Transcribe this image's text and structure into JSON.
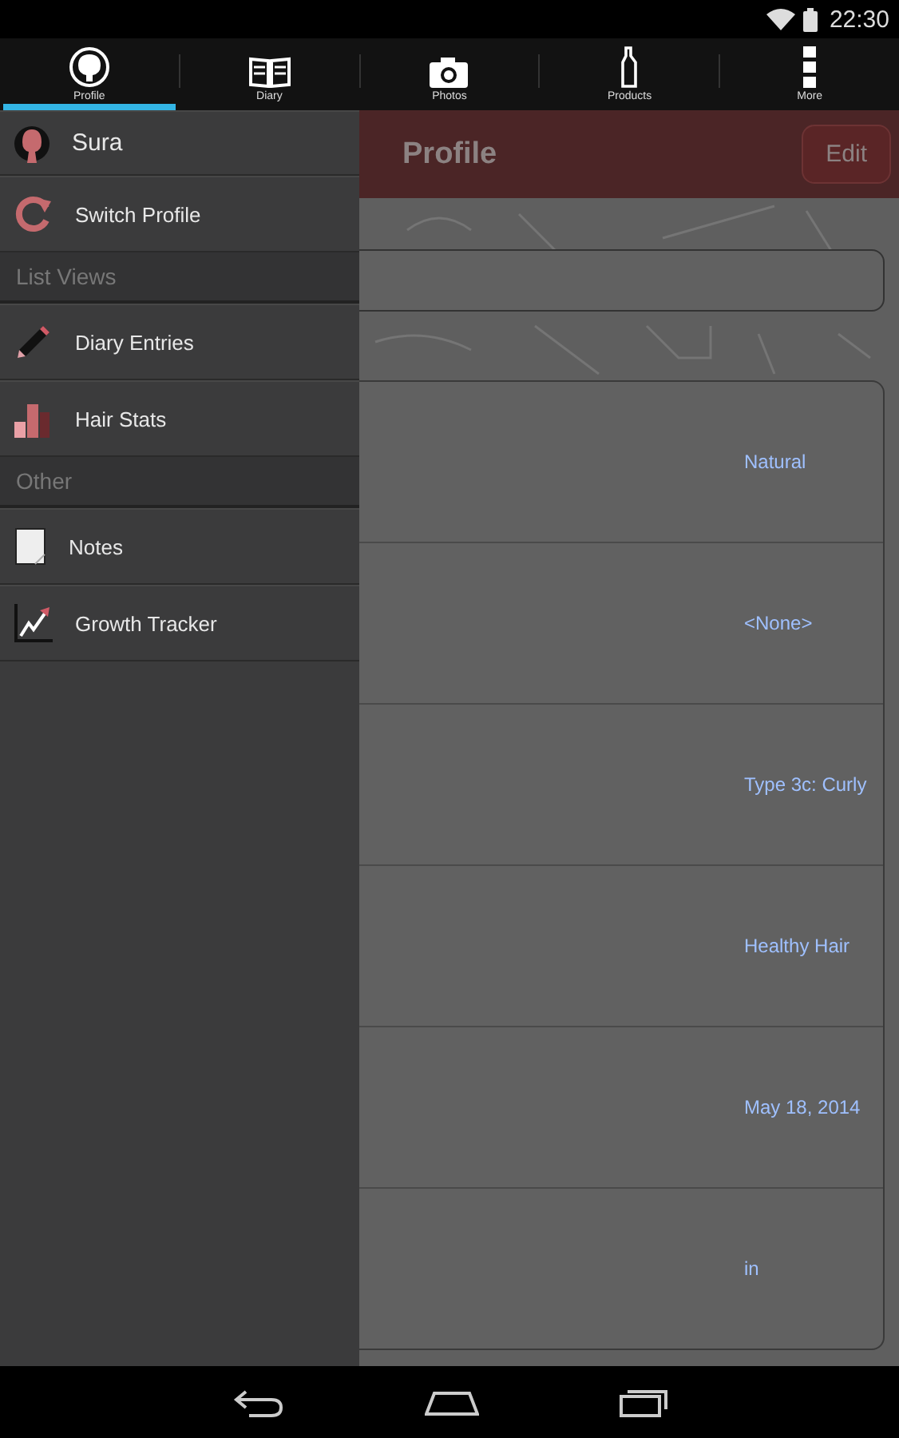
{
  "status_bar": {
    "time": "22:30"
  },
  "tabs": [
    {
      "label": "Profile",
      "selected": true
    },
    {
      "label": "Diary",
      "selected": false
    },
    {
      "label": "Photos",
      "selected": false
    },
    {
      "label": "Products",
      "selected": false
    },
    {
      "label": "More",
      "selected": false
    }
  ],
  "header": {
    "title": "Profile",
    "edit_button": "Edit"
  },
  "profile_rows": [
    {
      "value": "Natural"
    },
    {
      "value": "<None>"
    },
    {
      "value": "Type 3c: Curly"
    },
    {
      "value": "Healthy Hair"
    },
    {
      "value": "May 18, 2014"
    },
    {
      "value": "in"
    }
  ],
  "drawer": [
    {
      "kind": "item",
      "label": "Sura"
    },
    {
      "kind": "item",
      "label": "Switch Profile"
    },
    {
      "kind": "header",
      "label": "List Views"
    },
    {
      "kind": "item",
      "label": "Diary Entries"
    },
    {
      "kind": "item",
      "label": "Hair Stats"
    },
    {
      "kind": "header",
      "label": "Other"
    },
    {
      "kind": "item",
      "label": "Notes"
    },
    {
      "kind": "item",
      "label": "Growth Tracker"
    }
  ]
}
